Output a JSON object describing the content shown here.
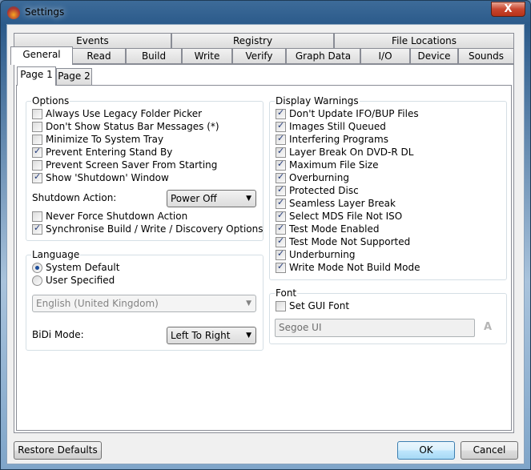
{
  "window": {
    "title": "Settings",
    "close_label": "X"
  },
  "tabs_row1": [
    "Events",
    "Registry",
    "File Locations"
  ],
  "tabs_row2": [
    "General",
    "Read",
    "Build",
    "Write",
    "Verify",
    "Graph Data",
    "I/O",
    "Device",
    "Sounds"
  ],
  "selected_tab": "General",
  "subtabs": [
    "Page 1",
    "Page 2"
  ],
  "options": {
    "title": "Options",
    "items": [
      {
        "label": "Always Use Legacy Folder Picker",
        "checked": false
      },
      {
        "label": "Don't Show Status Bar Messages (*)",
        "checked": false
      },
      {
        "label": "Minimize To System Tray",
        "checked": false
      },
      {
        "label": "Prevent Entering Stand By",
        "checked": true
      },
      {
        "label": "Prevent Screen Saver From Starting",
        "checked": false
      },
      {
        "label": "Show 'Shutdown' Window",
        "checked": true
      }
    ],
    "shutdown_label": "Shutdown Action:",
    "shutdown_value": "Power Off",
    "items2": [
      {
        "label": "Never Force Shutdown Action",
        "checked": false
      },
      {
        "label": "Synchronise Build / Write / Discovery Options",
        "checked": true
      }
    ]
  },
  "language": {
    "title": "Language",
    "radios": [
      {
        "label": "System Default",
        "selected": true
      },
      {
        "label": "User Specified",
        "selected": false
      }
    ],
    "language_value": "English (United Kingdom)",
    "bidi_label": "BiDi Mode:",
    "bidi_value": "Left To Right"
  },
  "warnings": {
    "title": "Display Warnings",
    "items": [
      {
        "label": "Don't Update IFO/BUP Files",
        "checked": true
      },
      {
        "label": "Images Still Queued",
        "checked": true
      },
      {
        "label": "Interfering Programs",
        "checked": true
      },
      {
        "label": "Layer Break On DVD-R DL",
        "checked": true
      },
      {
        "label": "Maximum File Size",
        "checked": true
      },
      {
        "label": "Overburning",
        "checked": true
      },
      {
        "label": "Protected Disc",
        "checked": true
      },
      {
        "label": "Seamless Layer Break",
        "checked": true
      },
      {
        "label": "Select MDS File Not ISO",
        "checked": true
      },
      {
        "label": "Test Mode Enabled",
        "checked": true
      },
      {
        "label": "Test Mode Not Supported",
        "checked": true
      },
      {
        "label": "Underburning",
        "checked": true
      },
      {
        "label": "Write Mode Not Build Mode",
        "checked": true
      }
    ]
  },
  "font": {
    "title": "Font",
    "set_label": "Set GUI Font",
    "checked": false,
    "value": "Segoe UI",
    "icon": "font-icon"
  },
  "buttons": {
    "restore": "Restore Defaults",
    "ok": "OK",
    "cancel": "Cancel"
  }
}
